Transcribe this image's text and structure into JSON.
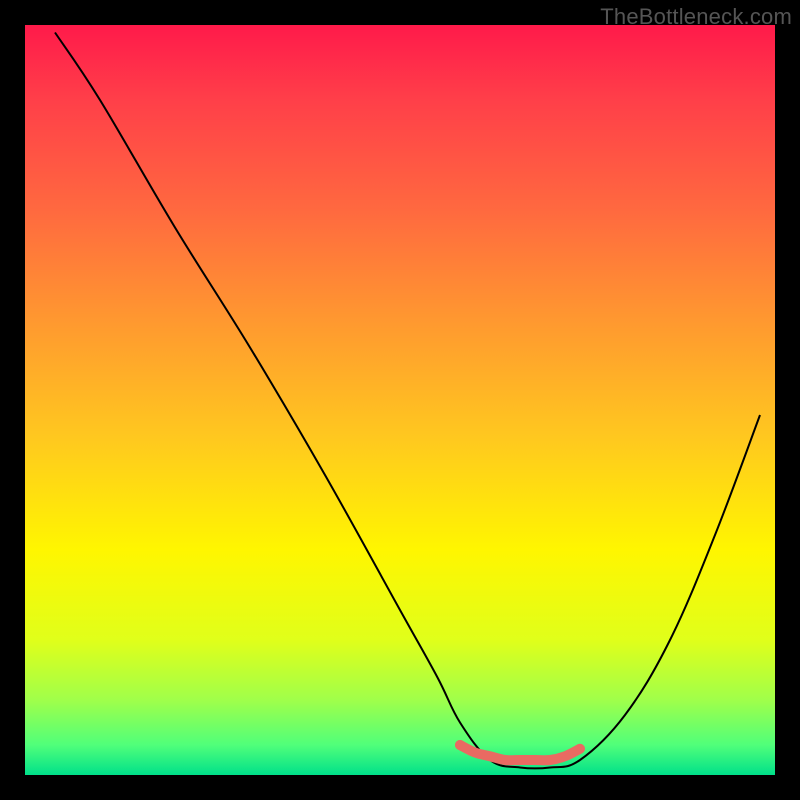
{
  "watermark": "TheBottleneck.com",
  "chart_data": {
    "type": "line",
    "title": "",
    "xlabel": "",
    "ylabel": "",
    "xlim": [
      0,
      100
    ],
    "ylim": [
      0,
      100
    ],
    "background_gradient": {
      "stops": [
        {
          "offset": 0.0,
          "color": "#ff1a4a"
        },
        {
          "offset": 0.1,
          "color": "#ff3f49"
        },
        {
          "offset": 0.25,
          "color": "#ff6a3f"
        },
        {
          "offset": 0.4,
          "color": "#ff9a2f"
        },
        {
          "offset": 0.55,
          "color": "#ffc81f"
        },
        {
          "offset": 0.7,
          "color": "#fff600"
        },
        {
          "offset": 0.82,
          "color": "#e0ff1a"
        },
        {
          "offset": 0.9,
          "color": "#a0ff4a"
        },
        {
          "offset": 0.96,
          "color": "#50ff7a"
        },
        {
          "offset": 1.0,
          "color": "#00e08a"
        }
      ]
    },
    "series": [
      {
        "name": "bottleneck-curve",
        "color": "#000000",
        "width": 2.0,
        "type": "curve",
        "x": [
          4,
          10,
          20,
          30,
          40,
          50,
          55,
          58,
          62,
          66,
          70,
          74,
          80,
          86,
          92,
          98
        ],
        "y": [
          99,
          90,
          73,
          57,
          40,
          22,
          13,
          7,
          2,
          1,
          1,
          2,
          8,
          18,
          32,
          48
        ]
      },
      {
        "name": "optimal-range-marker",
        "color": "#e96a62",
        "width": 10,
        "type": "marker",
        "x": [
          58,
          60,
          62,
          64,
          66,
          68,
          70,
          72,
          74
        ],
        "y": [
          4,
          3,
          2.5,
          2,
          2,
          2,
          2,
          2.5,
          3.5
        ]
      }
    ],
    "marker_dot": {
      "x": 58,
      "y": 4,
      "r": 5,
      "color": "#e96a62"
    }
  }
}
